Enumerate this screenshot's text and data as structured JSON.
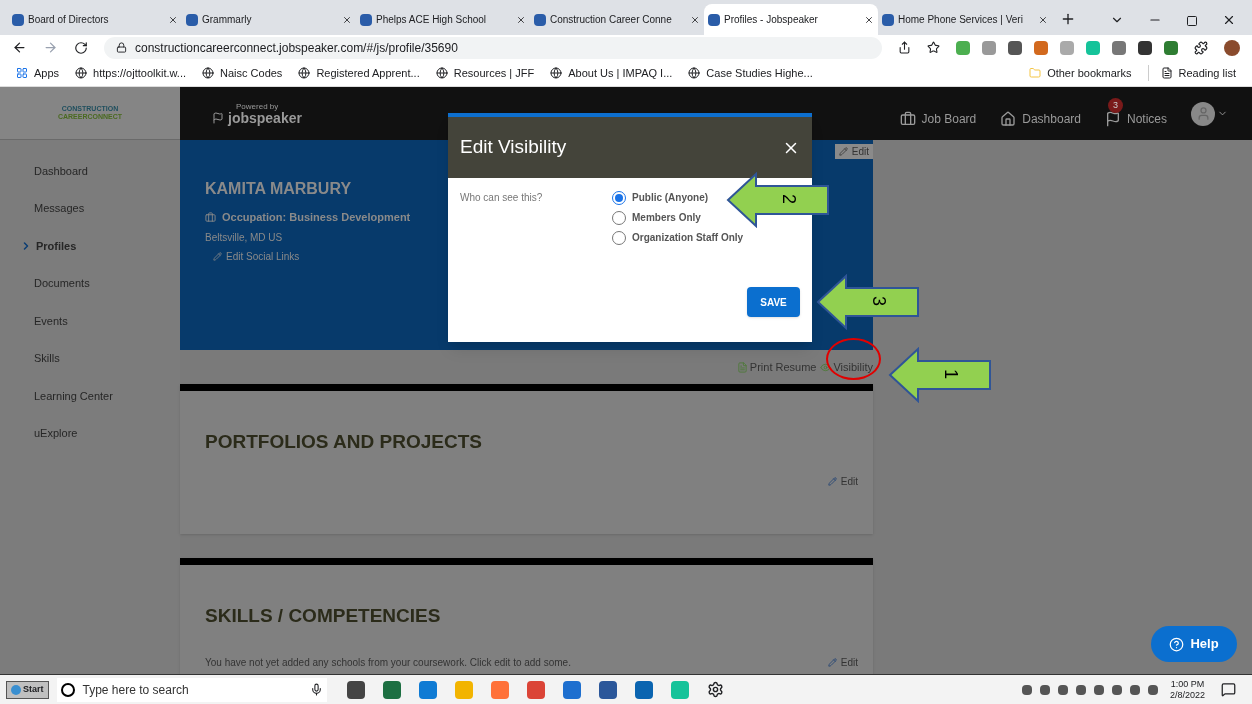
{
  "browser": {
    "tabs": [
      {
        "title": "Board of Directors",
        "selected": false
      },
      {
        "title": "Grammarly",
        "selected": false
      },
      {
        "title": "Phelps ACE High School",
        "selected": false
      },
      {
        "title": "Construction Career Conne",
        "selected": false
      },
      {
        "title": "Profiles - Jobspeaker",
        "selected": true
      },
      {
        "title": "Home Phone Services | Veri",
        "selected": false
      }
    ],
    "url": "constructioncareerconnect.jobspeaker.com/#/js/profile/35690",
    "bookmarks": [
      {
        "label": "Apps"
      },
      {
        "label": "https://ojttoolkit.w..."
      },
      {
        "label": "Naisc Codes"
      },
      {
        "label": "Registered Apprent..."
      },
      {
        "label": "Resources | JFF"
      },
      {
        "label": "About Us | IMPAQ I..."
      },
      {
        "label": "Case Studies Highe..."
      }
    ],
    "other_bookmarks": "Other bookmarks",
    "reading_list": "Reading list"
  },
  "app": {
    "logo_lines": [
      "CONSTRUCTION",
      "CAREERCONNECT"
    ],
    "powered_by": "Powered by",
    "brand": "jobspeaker",
    "nav": [
      {
        "label": "Job Board",
        "kind": "briefcase"
      },
      {
        "label": "Dashboard",
        "kind": "home"
      },
      {
        "label": "Notices",
        "kind": "flag",
        "badge": "3"
      }
    ],
    "sidebar": [
      {
        "label": "Dashboard",
        "selected": false
      },
      {
        "label": "Messages",
        "selected": false
      },
      {
        "label": "Profiles",
        "selected": true
      },
      {
        "label": "Documents",
        "selected": false
      },
      {
        "label": "Events",
        "selected": false
      },
      {
        "label": "Skills",
        "selected": false
      },
      {
        "label": "Learning Center",
        "selected": false
      },
      {
        "label": "uExplore",
        "selected": false
      }
    ],
    "profile": {
      "name": "KAMITA MARBURY",
      "occupation": "Occupation: Business Development",
      "location": "Beltsville, MD US",
      "edit_social": "Edit Social Links",
      "edit": "Edit",
      "print_resume": "Print Resume",
      "visibility": "Visibility"
    },
    "sections": [
      {
        "title": "PORTFOLIOS AND PROJECTS",
        "edit": "Edit"
      },
      {
        "title": "SKILLS / COMPETENCIES",
        "text": "You have not yet added any schools from your coursework. Click edit to add some.",
        "edit": "Edit"
      }
    ],
    "help": "Help"
  },
  "modal": {
    "title": "Edit Visibility",
    "question": "Who can see this?",
    "options": [
      {
        "label": "Public (Anyone)",
        "selected": true
      },
      {
        "label": "Members Only",
        "selected": false
      },
      {
        "label": "Organization Staff Only",
        "selected": false
      }
    ],
    "save": "SAVE"
  },
  "annotations": [
    {
      "label": "1"
    },
    {
      "label": "2"
    },
    {
      "label": "3"
    }
  ],
  "taskbar": {
    "start": "Start",
    "search_placeholder": "Type here to search",
    "time": "1:00 PM",
    "date": "2/8/2022"
  }
}
